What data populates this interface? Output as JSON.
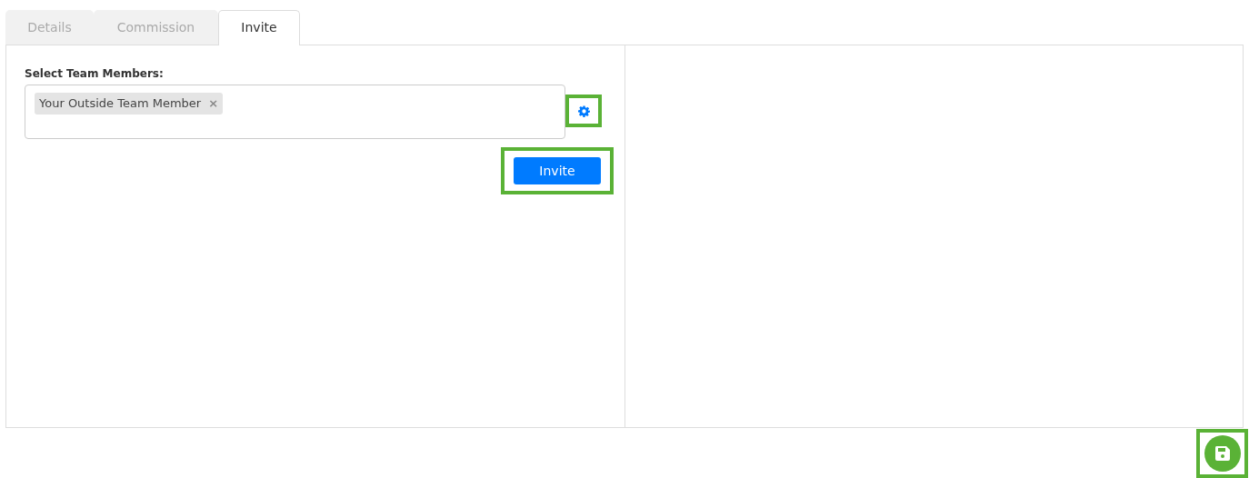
{
  "tabs": [
    {
      "label": "Details",
      "selected": false
    },
    {
      "label": "Commission",
      "selected": false
    },
    {
      "label": "Invite",
      "selected": true
    }
  ],
  "team_select": {
    "label": "Select Team Members:",
    "chips": [
      {
        "label": "Your Outside Team Member",
        "remove": "×"
      }
    ]
  },
  "invite_button": {
    "label": "Invite"
  }
}
